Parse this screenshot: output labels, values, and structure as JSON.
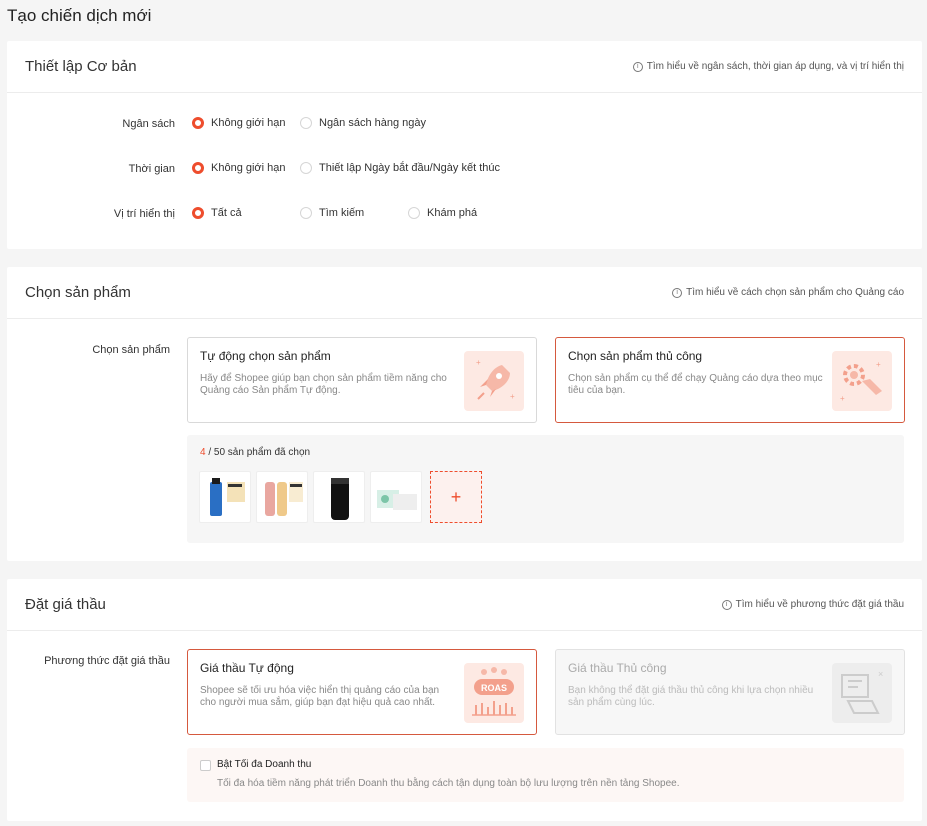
{
  "page": {
    "title": "Tạo chiến dịch mới"
  },
  "basic": {
    "title": "Thiết lập Cơ bản",
    "help": "Tìm hiểu về ngân sách, thời gian áp dụng, và vị trí hiển thị",
    "budget": {
      "label": "Ngân sách",
      "options": [
        "Không giới hạn",
        "Ngân sách hàng ngày"
      ],
      "selected": "Không giới hạn"
    },
    "time": {
      "label": "Thời gian",
      "options": [
        "Không giới hạn",
        "Thiết lập Ngày bắt đầu/Ngày kết thúc"
      ],
      "selected": "Không giới hạn"
    },
    "placement": {
      "label": "Vị trí hiển thị",
      "options": [
        "Tất cả",
        "Tìm kiếm",
        "Khám phá"
      ],
      "selected": "Tất cả"
    }
  },
  "products": {
    "title": "Chọn sản phẩm",
    "help": "Tìm hiểu về cách chọn sản phẩm cho Quảng cáo",
    "label": "Chọn sản phẩm",
    "auto": {
      "title": "Tự động chọn sản phẩm",
      "desc": "Hãy để Shopee giúp bạn chọn sản phẩm tiềm năng cho Quảng cáo Sản phẩm Tự động.",
      "icon": "rocket-icon"
    },
    "manual": {
      "title": "Chọn sản phẩm thủ công",
      "desc": "Chọn sản phẩm cụ thể để chạy Quảng cáo dựa theo mục tiêu của bạn.",
      "icon": "gear-hand-icon"
    },
    "selected_count": "4",
    "max_text": " / 50 sản phẩm đã chọn",
    "add_label": "+"
  },
  "bidding": {
    "title": "Đặt giá thầu",
    "help": "Tìm hiểu về phương thức đặt giá thầu",
    "label": "Phương thức đặt giá thầu",
    "auto": {
      "title": "Giá thầu Tự động",
      "desc": "Shopee sẽ tối ưu hóa việc hiển thị quảng cáo của bạn cho người mua sắm, giúp bạn đạt hiệu quả cao nhất.",
      "icon": "roas-icon",
      "badge": "ROAS"
    },
    "manual": {
      "title": "Giá thầu Thủ công",
      "desc": "Bạn không thể đặt giá thầu thủ công khi lựa chọn nhiều sản phẩm cùng lúc.",
      "icon": "manual-bid-icon"
    },
    "max_revenue": {
      "title": "Bật Tối đa Doanh thu",
      "desc": "Tối đa hóa tiềm năng phát triển Doanh thu bằng cách tận dụng toàn bộ lưu lượng trên nền tảng Shopee."
    }
  },
  "colors": {
    "accent": "#ee4d2d"
  }
}
